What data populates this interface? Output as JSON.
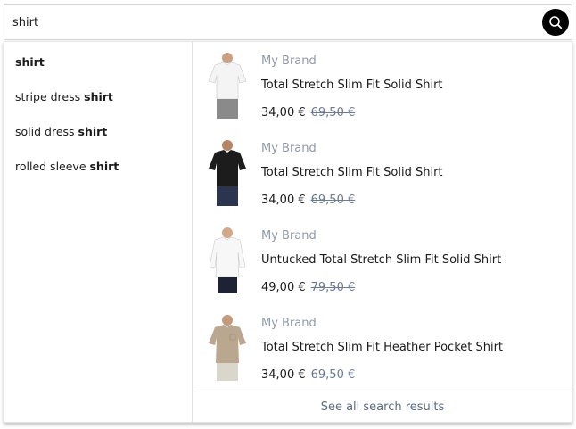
{
  "search": {
    "value": "shirt",
    "placeholder": ""
  },
  "suggestions": [
    {
      "prefix": "",
      "match": "shirt"
    },
    {
      "prefix": "stripe dress ",
      "match": "shirt"
    },
    {
      "prefix": "solid dress ",
      "match": "shirt"
    },
    {
      "prefix": "rolled sleeve ",
      "match": "shirt"
    }
  ],
  "products": [
    {
      "brand": "My Brand",
      "name": "Total Stretch Slim Fit Solid Shirt",
      "price": "34,00 €",
      "old_price": "69,50 €",
      "shirt_color": "#f4f4f4",
      "pants_color": "#8a8a8a"
    },
    {
      "brand": "My Brand",
      "name": "Total Stretch Slim Fit Solid Shirt",
      "price": "34,00 €",
      "old_price": "69,50 €",
      "shirt_color": "#1c1c1c",
      "pants_color": "#2c3550"
    },
    {
      "brand": "My Brand",
      "name": "Untucked Total Stretch Slim Fit Solid Shirt",
      "price": "49,00 €",
      "old_price": "79,50 €",
      "shirt_color": "#f7f7f7",
      "pants_color": "#1e2333"
    },
    {
      "brand": "My Brand",
      "name": "Total Stretch Slim Fit Heather Pocket Shirt",
      "price": "34,00 €",
      "old_price": "69,50 €",
      "shirt_color": "#b9a78f",
      "pants_color": "#d9d6cc"
    }
  ],
  "see_all_label": "See all search results",
  "colors": {
    "brand_text": "#8e9aa8",
    "old_price": "#6b7a8f",
    "search_button": "#000000"
  },
  "icons": {
    "search_button": "search-icon"
  }
}
